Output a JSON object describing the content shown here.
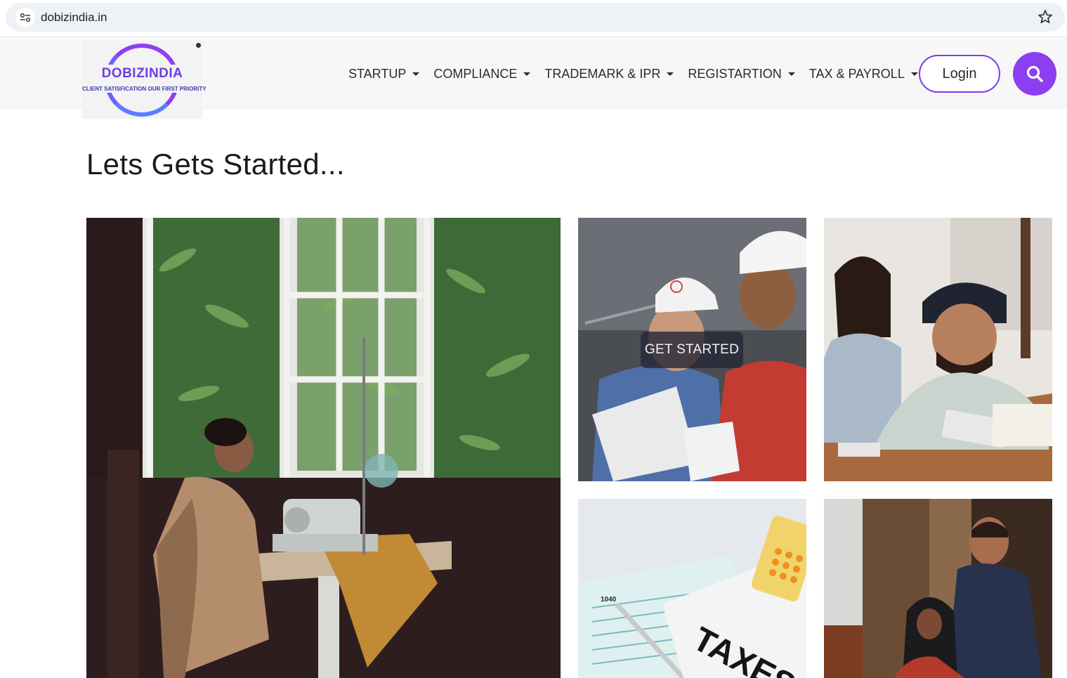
{
  "browser": {
    "url": "dobizindia.in"
  },
  "header": {
    "logo": {
      "name": "DOBIZINDIA",
      "tagline": "CLIENT SATISFICATION OUR FIRST PRIORITY"
    },
    "nav": [
      {
        "label": "STARTUP"
      },
      {
        "label": "COMPLIANCE"
      },
      {
        "label": "TRADEMARK & IPR"
      },
      {
        "label": "REGISTARTION"
      },
      {
        "label": "TAX & PAYROLL"
      }
    ],
    "login_label": "Login"
  },
  "main": {
    "heading": "Lets Gets Started...",
    "overlay_button": "GET STARTED",
    "tax_form_label": "1040",
    "tax_paper_text": "TAXES"
  },
  "colors": {
    "accent": "#8b3ff0",
    "login_border": "#7c3aed",
    "header_bg": "#f7f7f8"
  }
}
